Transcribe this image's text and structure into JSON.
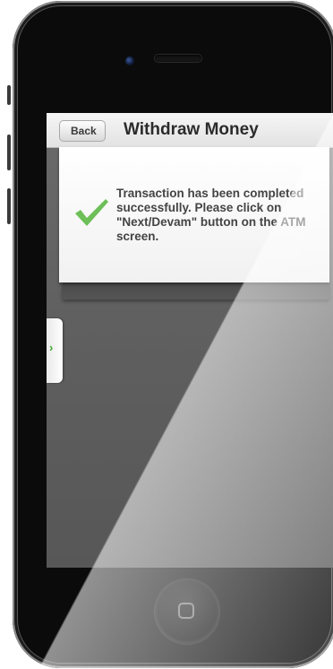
{
  "navbar": {
    "back_label": "Back",
    "title": "Withdraw Money"
  },
  "message": {
    "text": "Transaction has been completed successfully. Please click on \"Next/Devam\" button on the ATM screen."
  },
  "drawer": {
    "arrow": "›"
  },
  "colors": {
    "check": "#6dbf58",
    "accent": "#3fa82f"
  },
  "icons": [
    "checkmark-icon",
    "chevron-right-icon",
    "home-button-icon"
  ]
}
